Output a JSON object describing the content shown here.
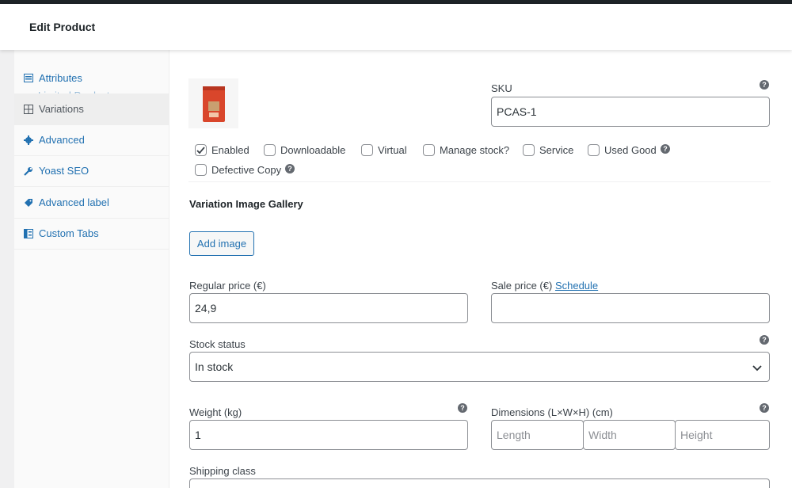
{
  "header": {
    "title": "Edit Product"
  },
  "sidebar": {
    "cutoff_label": "Limited Products",
    "items": [
      {
        "label": "Attributes",
        "icon": "list-icon"
      },
      {
        "label": "Variations",
        "icon": "grid-icon"
      },
      {
        "label": "Advanced",
        "icon": "gear-icon"
      },
      {
        "label": "Yoast SEO",
        "icon": "wrench-icon"
      },
      {
        "label": "Advanced label",
        "icon": "tag-icon"
      },
      {
        "label": "Custom Tabs",
        "icon": "tabs-icon"
      }
    ]
  },
  "variation": {
    "sku_label": "SKU",
    "sku_value": "PCAS-1",
    "options": [
      {
        "label": "Enabled",
        "checked": true
      },
      {
        "label": "Downloadable",
        "checked": false
      },
      {
        "label": "Virtual",
        "checked": false
      },
      {
        "label": "Manage stock?",
        "checked": false
      },
      {
        "label": "Service",
        "checked": false
      },
      {
        "label": "Used Good",
        "checked": false
      },
      {
        "label": "Defective Copy",
        "checked": false
      }
    ],
    "gallery_label": "Variation Image Gallery",
    "add_image_label": "Add image",
    "regular_price_label": "Regular price (€)",
    "regular_price_value": "24,9",
    "sale_price_label": "Sale price (€)",
    "schedule_label": "Schedule",
    "stock_status_label": "Stock status",
    "stock_status_value": "In stock",
    "weight_label": "Weight (kg)",
    "weight_value": "1",
    "dimensions_label": "Dimensions (L×W×H) (cm)",
    "length_placeholder": "Length",
    "width_placeholder": "Width",
    "height_placeholder": "Height",
    "shipping_class_label": "Shipping class"
  },
  "colors": {
    "accent": "#2271b1",
    "product": "#d9462b"
  }
}
